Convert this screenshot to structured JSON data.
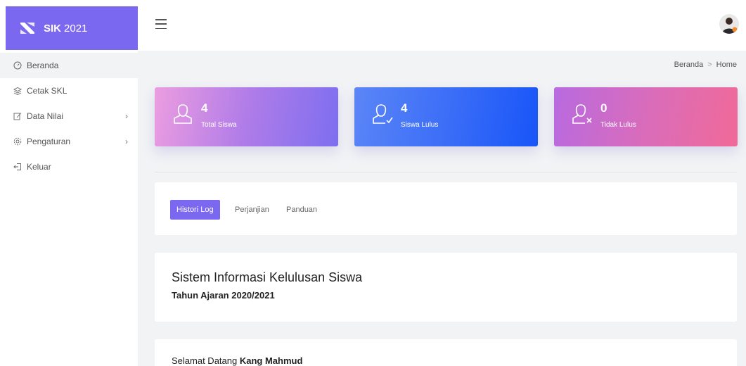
{
  "brand": {
    "name_bold": "SIK",
    "name_year": "2021"
  },
  "sidebar": {
    "items": [
      {
        "label": "Beranda",
        "icon": "speedometer-icon",
        "active": true,
        "has_children": false
      },
      {
        "label": "Cetak SKL",
        "icon": "layers-icon",
        "active": false,
        "has_children": false
      },
      {
        "label": "Data Nilai",
        "icon": "edit-icon",
        "active": false,
        "has_children": true
      },
      {
        "label": "Pengaturan",
        "icon": "gear-icon",
        "active": false,
        "has_children": true
      },
      {
        "label": "Keluar",
        "icon": "logout-icon",
        "active": false,
        "has_children": false
      }
    ]
  },
  "breadcrumb": {
    "parent": "Beranda",
    "current": "Home"
  },
  "stats": [
    {
      "value": "4",
      "label": "Total Siswa",
      "icon": "user-icon"
    },
    {
      "value": "4",
      "label": "Siswa Lulus",
      "icon": "user-check-icon"
    },
    {
      "value": "0",
      "label": "Tidak Lulus",
      "icon": "user-x-icon"
    }
  ],
  "tabs": [
    {
      "label": "Histori Log",
      "active": true
    },
    {
      "label": "Perjanjian",
      "active": false
    },
    {
      "label": "Panduan",
      "active": false
    }
  ],
  "info": {
    "title": "Sistem Informasi Kelulusan Siswa",
    "subtitle": "Tahun Ajaran 2020/2021"
  },
  "welcome": {
    "greeting": "Selamat Datang",
    "name": "Kang Mahmud"
  },
  "colors": {
    "accent": "#7a68f0",
    "card_blue": "#1855f8",
    "card_pink": "#f06a98"
  }
}
